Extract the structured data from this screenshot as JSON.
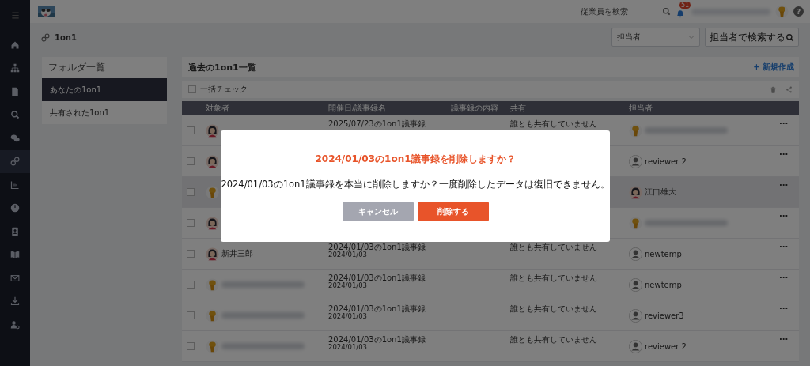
{
  "sidebar": {
    "items": [
      {
        "selected": false
      },
      {
        "selected": false
      },
      {
        "selected": false
      },
      {
        "selected": false
      },
      {
        "selected": false
      },
      {
        "selected": true
      },
      {
        "selected": false
      },
      {
        "selected": false
      },
      {
        "selected": false
      },
      {
        "selected": false
      },
      {
        "selected": false
      },
      {
        "selected": false
      },
      {
        "selected": false
      }
    ]
  },
  "topbar": {
    "search": {
      "placeholder": "従業員を検索"
    },
    "notifications": {
      "count": "51"
    },
    "help": "?"
  },
  "page": {
    "title": "1on1",
    "filter": {
      "value": "担当者"
    },
    "search": {
      "placeholder": "担当者で検索する"
    }
  },
  "folders": {
    "title": "フォルダ一覧",
    "items": [
      {
        "label": "あなたの1on1",
        "selected": true
      },
      {
        "label": "共有された1on1",
        "selected": false
      }
    ]
  },
  "list": {
    "title": "過去の1on1一覧",
    "new_button": "+ 新規作成",
    "bulk_check": {
      "label": "一括チェック",
      "checked": false
    },
    "columns": [
      "対象者",
      "開催日/議事録名",
      "議事録の内容",
      "共有",
      "担当者"
    ],
    "rows": [
      {
        "checked": false,
        "selected": false,
        "avatar": {
          "kind": "cartoon"
        },
        "title": "2025/07/23の1on1議事録",
        "shared": "誰とも共有していません",
        "assignee_avatar": {
          "kind": "mascot"
        },
        "assignee_blurred": true,
        "menu": "···"
      },
      {
        "checked": false,
        "selected": false,
        "avatar": {
          "kind": "cartoon"
        },
        "assignee_avatar": {
          "kind": "default"
        },
        "assignee": "reviewer 2",
        "menu": "···"
      },
      {
        "checked": false,
        "selected": true,
        "avatar": {
          "kind": "mascot"
        },
        "assignee_avatar": {
          "kind": "cartoon"
        },
        "assignee": "江口雄大",
        "menu": "···"
      },
      {
        "checked": false,
        "selected": false,
        "avatar": {
          "kind": "cartoon"
        },
        "assignee_avatar": {
          "kind": "mascot"
        },
        "assignee_blurred": true,
        "menu": "···"
      },
      {
        "checked": false,
        "selected": false,
        "avatar": {
          "kind": "cartoon"
        },
        "name": "新井三郎",
        "title": "2024/01/03の1on1議事録",
        "date": "2024/01/03",
        "shared": "誰とも共有していません",
        "assignee_avatar": {
          "kind": "default"
        },
        "assignee": "newtemp",
        "menu": "···"
      },
      {
        "checked": false,
        "selected": false,
        "avatar": {
          "kind": "mascot"
        },
        "name_blurred": true,
        "title": "2024/01/03の1on1議事録",
        "date": "2024/01/03",
        "shared": "誰とも共有していません",
        "assignee_avatar": {
          "kind": "default"
        },
        "assignee": "newtemp",
        "menu": "···"
      },
      {
        "checked": false,
        "selected": false,
        "avatar": {
          "kind": "mascot"
        },
        "name_blurred": true,
        "title": "2024/01/03の1on1議事録",
        "date": "2024/01/03",
        "shared": "誰とも共有していません",
        "assignee_avatar": {
          "kind": "default"
        },
        "assignee": "reviewer3",
        "menu": "···"
      },
      {
        "checked": false,
        "selected": false,
        "avatar": {
          "kind": "mascot"
        },
        "name_blurred": true,
        "title": "2024/01/03の1on1議事録",
        "date": "2024/01/03",
        "shared": "誰とも共有していません",
        "assignee_avatar": {
          "kind": "default"
        },
        "assignee": "reviewer 2",
        "menu": "···"
      }
    ]
  },
  "dialog": {
    "title": "2024/01/03の1on1議事録を削除しますか？",
    "message": "2024/01/03の1on1議事録を本当に削除しますか？一度削除したデータは復旧できません。",
    "buttons": [
      {
        "label": "キャンセル",
        "kind": "secondary"
      },
      {
        "label": "削除する",
        "kind": "danger"
      }
    ]
  }
}
